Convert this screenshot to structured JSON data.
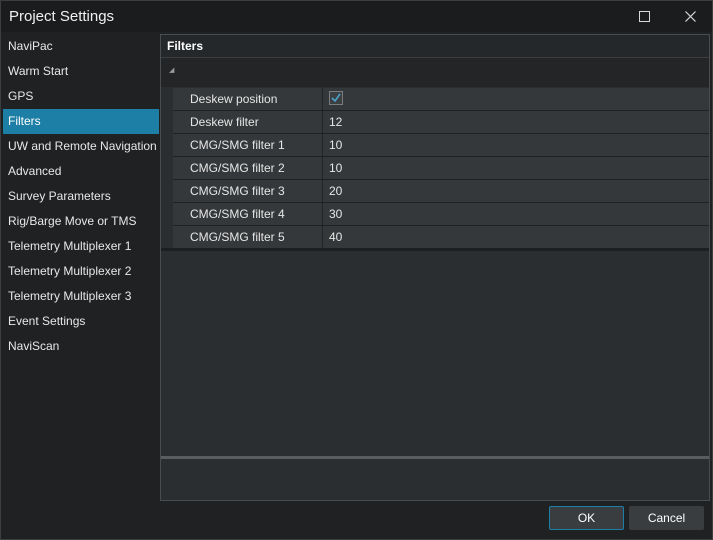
{
  "window": {
    "title": "Project Settings",
    "maximize_icon": "maximize-icon",
    "close_icon": "close-icon"
  },
  "sidebar": {
    "items": [
      {
        "label": "NaviPac",
        "active": false
      },
      {
        "label": "Warm Start",
        "active": false
      },
      {
        "label": "GPS",
        "active": false
      },
      {
        "label": "Filters",
        "active": true
      },
      {
        "label": "UW and Remote Navigation",
        "active": false
      },
      {
        "label": "Advanced",
        "active": false
      },
      {
        "label": "Survey Parameters",
        "active": false
      },
      {
        "label": "Rig/Barge Move or TMS",
        "active": false
      },
      {
        "label": "Telemetry Multiplexer 1",
        "active": false
      },
      {
        "label": "Telemetry Multiplexer 2",
        "active": false
      },
      {
        "label": "Telemetry Multiplexer 3",
        "active": false
      },
      {
        "label": "Event Settings",
        "active": false
      },
      {
        "label": "NaviScan",
        "active": false
      }
    ]
  },
  "content": {
    "title": "Filters",
    "properties": [
      {
        "label": "Deskew position",
        "value": "",
        "checked": true
      },
      {
        "label": "Deskew filter",
        "value": "12"
      },
      {
        "label": "CMG/SMG filter 1",
        "value": "10"
      },
      {
        "label": "CMG/SMG filter 2",
        "value": "10"
      },
      {
        "label": "CMG/SMG filter 3",
        "value": "20"
      },
      {
        "label": "CMG/SMG filter 4",
        "value": "30"
      },
      {
        "label": "CMG/SMG filter 5",
        "value": "40"
      }
    ]
  },
  "buttons": {
    "ok_label": "OK",
    "cancel_label": "Cancel"
  },
  "colors": {
    "accent": "#1d7fa6",
    "check": "#4aa3c8"
  }
}
